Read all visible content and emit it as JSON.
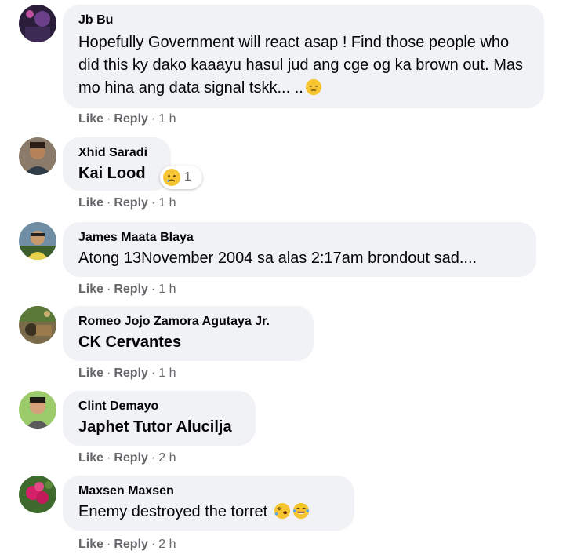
{
  "actions": {
    "like_label": "Like",
    "reply_label": "Reply",
    "separator": "·"
  },
  "comments": [
    {
      "author": "Jb Bu",
      "text": "Hopefully Government will react asap ! Find those people who did this ky dako kaaayu hasul jud ang cge og ka brown out. Mas mo hina ang data signal tskk... ..",
      "time": "1 h",
      "emoji": "pensive-face"
    },
    {
      "author": "Xhid Saradi",
      "text": "Kai Lood",
      "time": "1 h",
      "reaction": {
        "icon": "sad-face",
        "count": "1"
      }
    },
    {
      "author": "James Maata Blaya",
      "text": "Atong 13November 2004 sa alas 2:17am brondout sad....",
      "time": "1 h"
    },
    {
      "author": "Romeo Jojo Zamora Agutaya Jr.",
      "text": "CK Cervantes",
      "time": "1 h"
    },
    {
      "author": "Clint Demayo",
      "text": "Japhet Tutor Alucilja",
      "time": "2 h"
    },
    {
      "author": "Maxsen Maxsen",
      "text": "Enemy destroyed the torret",
      "time": "2 h",
      "emojis": [
        "rolling-laughing-face",
        "tears-of-joy-face"
      ]
    }
  ],
  "colors": {
    "bubble": "#f0f2f5",
    "meta": "#65676b",
    "text": "#050505"
  }
}
